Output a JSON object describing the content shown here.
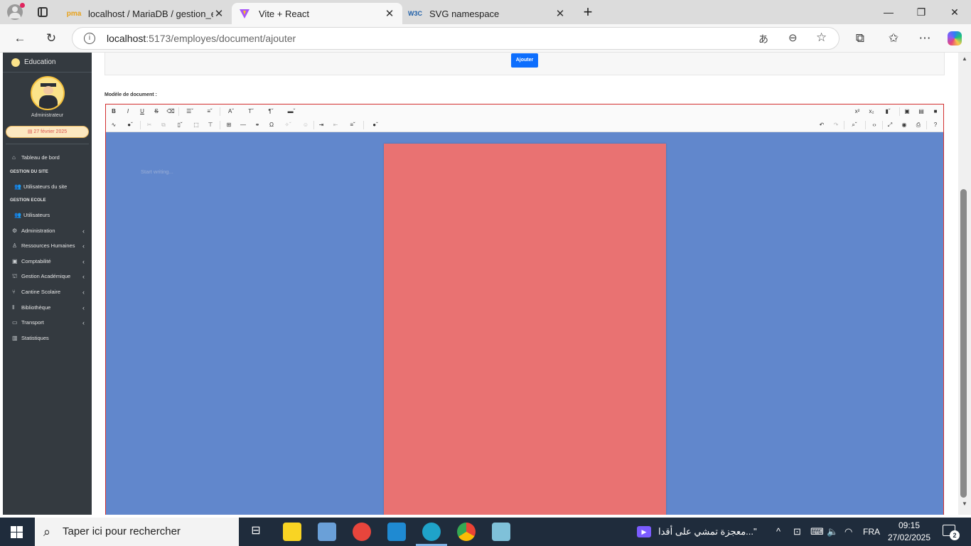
{
  "browser": {
    "tabs": [
      {
        "title": "localhost / MariaDB / gestion_eco",
        "favicon": "pma-icon",
        "active": false
      },
      {
        "title": "Vite + React",
        "favicon": "vite-icon",
        "active": true
      },
      {
        "title": "SVG namespace",
        "favicon": "w3c-icon",
        "active": false
      }
    ],
    "url_host": "localhost",
    "url_rest": ":5173/employes/document/ajouter"
  },
  "sidebar": {
    "brand": "Education",
    "role": "Administrateur",
    "date": "27 février 2025",
    "items": [
      {
        "label": "Tableau de bord",
        "icon": "home-icon",
        "chevron": false
      },
      {
        "label": "Utilisateurs du site",
        "icon": "users-icon",
        "chevron": false
      },
      {
        "label": "Utilisateurs",
        "icon": "users-icon",
        "chevron": false
      },
      {
        "label": "Administration",
        "icon": "cog-icon",
        "chevron": true
      },
      {
        "label": "Ressources Humaines",
        "icon": "user-cog-icon",
        "chevron": true
      },
      {
        "label": "Comptabilité",
        "icon": "money-icon",
        "chevron": true
      },
      {
        "label": "Gestion Académique",
        "icon": "school-icon",
        "chevron": true
      },
      {
        "label": "Cantine Scolaire",
        "icon": "utensils-icon",
        "chevron": true
      },
      {
        "label": "Bibliothèque",
        "icon": "book-icon",
        "chevron": true
      },
      {
        "label": "Transport",
        "icon": "bus-icon",
        "chevron": true
      },
      {
        "label": "Statistiques",
        "icon": "chart-icon",
        "chevron": false
      }
    ],
    "sections": {
      "site": "GESTION DU SITE",
      "ecole": "GESTION ECOLE"
    }
  },
  "main": {
    "add_button": "Ajouter",
    "model_label": "Modèle de document :",
    "editor_placeholder": "Start writing...",
    "editor_bg": "#6187cc",
    "page_color": "#e97272"
  },
  "taskbar": {
    "search_placeholder": "Taper ici pour rechercher",
    "media_title": "\"...معجزة تمشي على أقدا",
    "language": "FRA",
    "time": "09:15",
    "date": "27/02/2025",
    "notifications": "2"
  }
}
